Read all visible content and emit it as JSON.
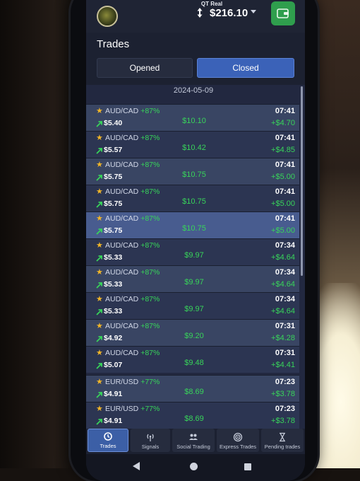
{
  "header": {
    "account_label": "QT Real",
    "balance": "$216.10"
  },
  "section_title": "Trades",
  "tabs": [
    {
      "label": "Opened",
      "active": false
    },
    {
      "label": "Closed",
      "active": true
    }
  ],
  "date": "2024-05-09",
  "trades": [
    {
      "pair": "AUD/CAD",
      "payout": "+87%",
      "amount": "$5.40",
      "total": "$10.10",
      "time": "07:41",
      "profit": "+$4.70"
    },
    {
      "pair": "AUD/CAD",
      "payout": "+87%",
      "amount": "$5.57",
      "total": "$10.42",
      "time": "07:41",
      "profit": "+$4.85"
    },
    {
      "pair": "AUD/CAD",
      "payout": "+87%",
      "amount": "$5.75",
      "total": "$10.75",
      "time": "07:41",
      "profit": "+$5.00"
    },
    {
      "pair": "AUD/CAD",
      "payout": "+87%",
      "amount": "$5.75",
      "total": "$10.75",
      "time": "07:41",
      "profit": "+$5.00"
    },
    {
      "pair": "AUD/CAD",
      "payout": "+87%",
      "amount": "$5.75",
      "total": "$10.75",
      "time": "07:41",
      "profit": "+$5.00"
    },
    {
      "pair": "AUD/CAD",
      "payout": "+87%",
      "amount": "$5.33",
      "total": "$9.97",
      "time": "07:34",
      "profit": "+$4.64"
    },
    {
      "pair": "AUD/CAD",
      "payout": "+87%",
      "amount": "$5.33",
      "total": "$9.97",
      "time": "07:34",
      "profit": "+$4.64"
    },
    {
      "pair": "AUD/CAD",
      "payout": "+87%",
      "amount": "$5.33",
      "total": "$9.97",
      "time": "07:34",
      "profit": "+$4.64"
    },
    {
      "pair": "AUD/CAD",
      "payout": "+87%",
      "amount": "$4.92",
      "total": "$9.20",
      "time": "07:31",
      "profit": "+$4.28"
    },
    {
      "pair": "AUD/CAD",
      "payout": "+87%",
      "amount": "$5.07",
      "total": "$9.48",
      "time": "07:31",
      "profit": "+$4.41"
    },
    {
      "pair": "EUR/USD",
      "payout": "+77%",
      "amount": "$4.91",
      "total": "$8.69",
      "time": "07:23",
      "profit": "+$3.78"
    },
    {
      "pair": "EUR/USD",
      "payout": "+77%",
      "amount": "$4.91",
      "total": "$8.69",
      "time": "07:23",
      "profit": "+$3.78"
    }
  ],
  "bottom_nav": [
    {
      "label": "Trades",
      "icon": "history-icon",
      "active": true
    },
    {
      "label": "Signals",
      "icon": "antenna-icon",
      "active": false
    },
    {
      "label": "Social Trading",
      "icon": "people-icon",
      "active": false
    },
    {
      "label": "Express Trades",
      "icon": "target-icon",
      "active": false
    },
    {
      "label": "Pending trades",
      "icon": "hourglass-icon",
      "active": false
    }
  ],
  "colors": {
    "accent_blue": "#3b62b8",
    "profit_green": "#38d45a",
    "wallet_green": "#2f9e4d",
    "star_gold": "#f0b529"
  }
}
